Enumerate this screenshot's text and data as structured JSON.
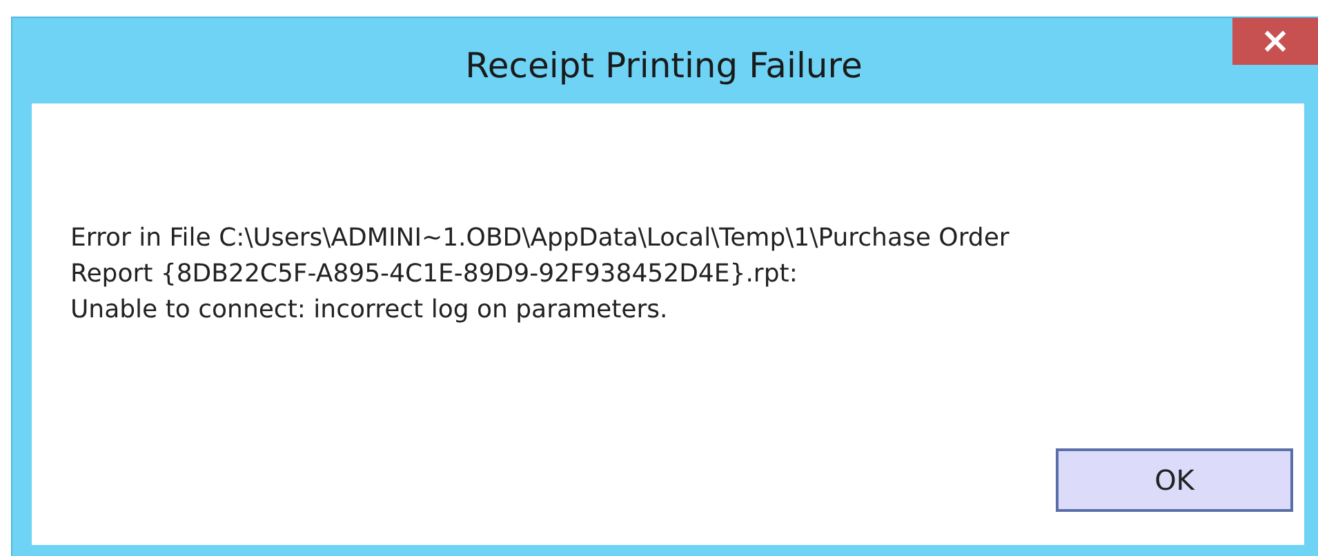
{
  "window": {
    "title": "Receipt Printing Failure",
    "close_glyph": "×"
  },
  "message_lines": [
    "Error in File C:\\Users\\ADMINI~1.OBD\\AppData\\Local\\Temp\\1\\Purchase Order",
    "Report {8DB22C5F-A895-4C1E-89D9-92F938452D4E}.rpt:",
    "Unable to connect: incorrect log on parameters."
  ],
  "buttons": [
    {
      "label": "OK",
      "selected": true
    }
  ]
}
